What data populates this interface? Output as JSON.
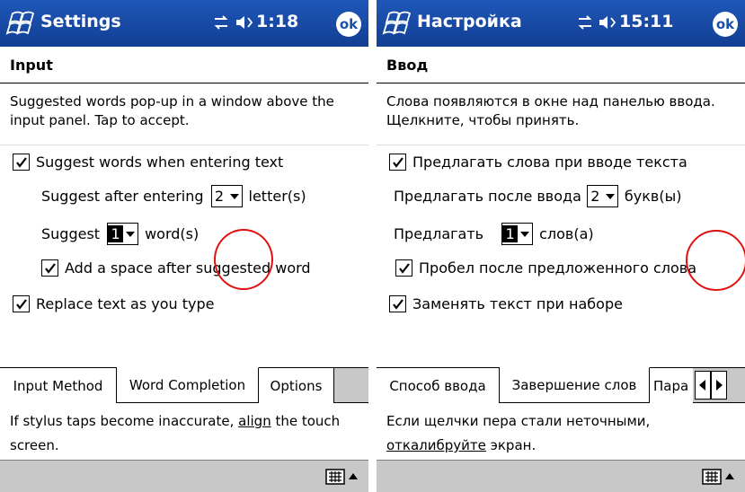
{
  "screens": [
    {
      "app_title": "Settings",
      "clock": "1:18",
      "ok_label": "ok",
      "heading": "Input",
      "description": "Suggested words pop-up in a window above the input panel.  Tap to accept.",
      "option_suggest_words": {
        "label": "Suggest words when entering text",
        "checked": true
      },
      "suggest_after": {
        "prefix": "Suggest after entering",
        "value": "2",
        "suffix": "letter(s)"
      },
      "suggest_count": {
        "prefix": "Suggest",
        "value": "1",
        "suffix": "word(s)"
      },
      "option_add_space": {
        "label": "Add a space after suggested word",
        "checked": true
      },
      "option_replace": {
        "label": "Replace text as you type",
        "checked": true
      },
      "tabs": [
        "Input Method",
        "Word Completion",
        "Options"
      ],
      "active_tab": "Word Completion",
      "footer": {
        "before": "If stylus taps become inaccurate, ",
        "link": "align",
        "after": " the touch screen."
      }
    },
    {
      "app_title": "Настройка",
      "clock": "15:11",
      "ok_label": "ok",
      "heading": "Ввод",
      "description": "Слова появляются в окне над панелью ввода. Щелкните, чтобы принять.",
      "option_suggest_words": {
        "label": "Предлагать слова при вводе текста",
        "checked": true
      },
      "suggest_after": {
        "prefix": "Предлагать после ввода",
        "value": "2",
        "suffix": "букв(ы)"
      },
      "suggest_count": {
        "prefix": "Предлагать",
        "value": "1",
        "suffix": "слов(а)"
      },
      "option_add_space": {
        "label": "Пробел после предложенного слова",
        "checked": true
      },
      "option_replace": {
        "label": "Заменять текст при наборе",
        "checked": true
      },
      "tabs": [
        "Способ ввода",
        "Завершение слов",
        "Пара"
      ],
      "active_tab": "Завершение слов",
      "footer": {
        "before": "Если щелчки пера стали неточными, ",
        "link": "откалибруйте",
        "after": " экран."
      }
    }
  ],
  "colors": {
    "titlebar": "#1f57b8",
    "annotation_circle": "#e01010",
    "bar_gray": "#c8c8c8"
  },
  "icons": [
    "windows-flag-icon",
    "connectivity-icon",
    "speaker-icon",
    "ok-icon",
    "keyboard-icon",
    "input-arrow-icon",
    "scroll-left-icon",
    "scroll-right-icon"
  ]
}
